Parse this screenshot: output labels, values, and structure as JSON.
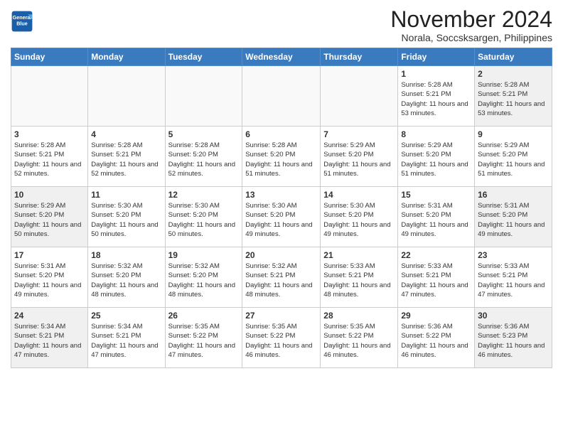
{
  "logo": {
    "line1": "General",
    "line2": "Blue"
  },
  "title": "November 2024",
  "location": "Norala, Soccsksargen, Philippines",
  "days_of_week": [
    "Sunday",
    "Monday",
    "Tuesday",
    "Wednesday",
    "Thursday",
    "Friday",
    "Saturday"
  ],
  "weeks": [
    [
      {
        "day": "",
        "empty": true
      },
      {
        "day": "",
        "empty": true
      },
      {
        "day": "",
        "empty": true
      },
      {
        "day": "",
        "empty": true
      },
      {
        "day": "",
        "empty": true
      },
      {
        "day": "1",
        "info": "Sunrise: 5:28 AM\nSunset: 5:21 PM\nDaylight: 11 hours\nand 53 minutes."
      },
      {
        "day": "2",
        "info": "Sunrise: 5:28 AM\nSunset: 5:21 PM\nDaylight: 11 hours\nand 53 minutes."
      }
    ],
    [
      {
        "day": "3",
        "info": "Sunrise: 5:28 AM\nSunset: 5:21 PM\nDaylight: 11 hours\nand 52 minutes."
      },
      {
        "day": "4",
        "info": "Sunrise: 5:28 AM\nSunset: 5:21 PM\nDaylight: 11 hours\nand 52 minutes."
      },
      {
        "day": "5",
        "info": "Sunrise: 5:28 AM\nSunset: 5:20 PM\nDaylight: 11 hours\nand 52 minutes."
      },
      {
        "day": "6",
        "info": "Sunrise: 5:28 AM\nSunset: 5:20 PM\nDaylight: 11 hours\nand 51 minutes."
      },
      {
        "day": "7",
        "info": "Sunrise: 5:29 AM\nSunset: 5:20 PM\nDaylight: 11 hours\nand 51 minutes."
      },
      {
        "day": "8",
        "info": "Sunrise: 5:29 AM\nSunset: 5:20 PM\nDaylight: 11 hours\nand 51 minutes."
      },
      {
        "day": "9",
        "info": "Sunrise: 5:29 AM\nSunset: 5:20 PM\nDaylight: 11 hours\nand 51 minutes."
      }
    ],
    [
      {
        "day": "10",
        "info": "Sunrise: 5:29 AM\nSunset: 5:20 PM\nDaylight: 11 hours\nand 50 minutes."
      },
      {
        "day": "11",
        "info": "Sunrise: 5:30 AM\nSunset: 5:20 PM\nDaylight: 11 hours\nand 50 minutes."
      },
      {
        "day": "12",
        "info": "Sunrise: 5:30 AM\nSunset: 5:20 PM\nDaylight: 11 hours\nand 50 minutes."
      },
      {
        "day": "13",
        "info": "Sunrise: 5:30 AM\nSunset: 5:20 PM\nDaylight: 11 hours\nand 49 minutes."
      },
      {
        "day": "14",
        "info": "Sunrise: 5:30 AM\nSunset: 5:20 PM\nDaylight: 11 hours\nand 49 minutes."
      },
      {
        "day": "15",
        "info": "Sunrise: 5:31 AM\nSunset: 5:20 PM\nDaylight: 11 hours\nand 49 minutes."
      },
      {
        "day": "16",
        "info": "Sunrise: 5:31 AM\nSunset: 5:20 PM\nDaylight: 11 hours\nand 49 minutes."
      }
    ],
    [
      {
        "day": "17",
        "info": "Sunrise: 5:31 AM\nSunset: 5:20 PM\nDaylight: 11 hours\nand 49 minutes."
      },
      {
        "day": "18",
        "info": "Sunrise: 5:32 AM\nSunset: 5:20 PM\nDaylight: 11 hours\nand 48 minutes."
      },
      {
        "day": "19",
        "info": "Sunrise: 5:32 AM\nSunset: 5:20 PM\nDaylight: 11 hours\nand 48 minutes."
      },
      {
        "day": "20",
        "info": "Sunrise: 5:32 AM\nSunset: 5:21 PM\nDaylight: 11 hours\nand 48 minutes."
      },
      {
        "day": "21",
        "info": "Sunrise: 5:33 AM\nSunset: 5:21 PM\nDaylight: 11 hours\nand 48 minutes."
      },
      {
        "day": "22",
        "info": "Sunrise: 5:33 AM\nSunset: 5:21 PM\nDaylight: 11 hours\nand 47 minutes."
      },
      {
        "day": "23",
        "info": "Sunrise: 5:33 AM\nSunset: 5:21 PM\nDaylight: 11 hours\nand 47 minutes."
      }
    ],
    [
      {
        "day": "24",
        "info": "Sunrise: 5:34 AM\nSunset: 5:21 PM\nDaylight: 11 hours\nand 47 minutes."
      },
      {
        "day": "25",
        "info": "Sunrise: 5:34 AM\nSunset: 5:21 PM\nDaylight: 11 hours\nand 47 minutes."
      },
      {
        "day": "26",
        "info": "Sunrise: 5:35 AM\nSunset: 5:22 PM\nDaylight: 11 hours\nand 47 minutes."
      },
      {
        "day": "27",
        "info": "Sunrise: 5:35 AM\nSunset: 5:22 PM\nDaylight: 11 hours\nand 46 minutes."
      },
      {
        "day": "28",
        "info": "Sunrise: 5:35 AM\nSunset: 5:22 PM\nDaylight: 11 hours\nand 46 minutes."
      },
      {
        "day": "29",
        "info": "Sunrise: 5:36 AM\nSunset: 5:22 PM\nDaylight: 11 hours\nand 46 minutes."
      },
      {
        "day": "30",
        "info": "Sunrise: 5:36 AM\nSunset: 5:23 PM\nDaylight: 11 hours\nand 46 minutes."
      }
    ]
  ]
}
